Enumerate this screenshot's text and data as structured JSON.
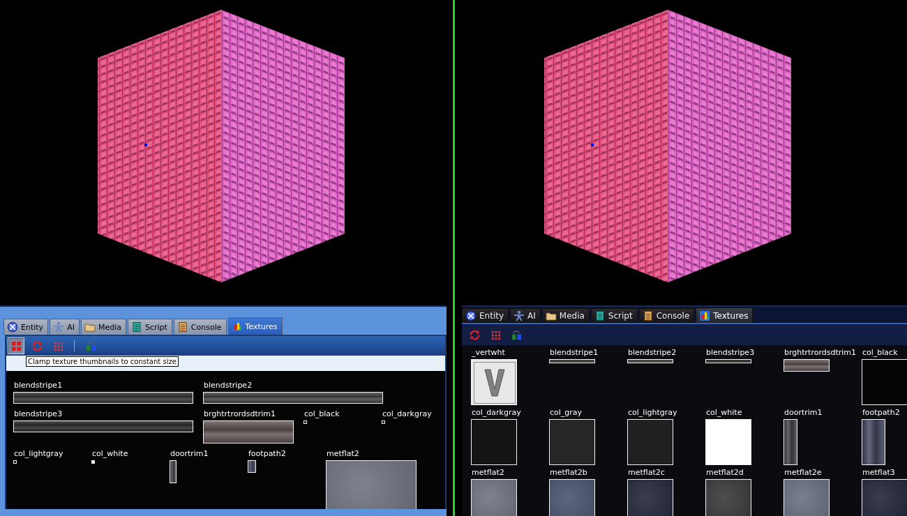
{
  "views": [
    {
      "kind": "light",
      "tabs": [
        {
          "label": "Entity",
          "kind": "entity",
          "selected": false
        },
        {
          "label": "AI",
          "kind": "ai",
          "selected": false
        },
        {
          "label": "Media",
          "kind": "media",
          "selected": false
        },
        {
          "label": "Script",
          "kind": "script",
          "selected": false
        },
        {
          "label": "Console",
          "kind": "console",
          "selected": false
        },
        {
          "label": "Textures",
          "kind": "textures",
          "selected": true
        }
      ],
      "toolbar": [
        {
          "kind": "clamp",
          "pressed": true
        },
        {
          "kind": "refresh",
          "pressed": false
        },
        {
          "kind": "dots",
          "pressed": false
        },
        {
          "kind": "separator"
        },
        {
          "kind": "swap",
          "pressed": false
        }
      ],
      "tooltip": "Clamp texture thumbnails to constant size",
      "textures": [
        {
          "name": "blendstripe1",
          "kind": "strip",
          "color": "#3c3c3c"
        },
        {
          "name": "blendstripe2",
          "kind": "strip",
          "color": "#4a4a4a"
        },
        {
          "name": "blendstripe3",
          "kind": "strip",
          "color": "#303030"
        },
        {
          "name": "brghtrtrordsdtrim1",
          "kind": "trim",
          "color": "#6a5c5c"
        },
        {
          "name": "col_black",
          "kind": "solid"
        },
        {
          "name": "col_darkgray",
          "kind": "solid"
        },
        {
          "name": "col_lightgray",
          "kind": "solid"
        },
        {
          "name": "col_white",
          "kind": "solid",
          "color": "#ffffff"
        },
        {
          "name": "doortrim1",
          "kind": "tall",
          "color": "#4a4a50"
        },
        {
          "name": "footpath2",
          "kind": "narrow",
          "color": "#4a4e66"
        },
        {
          "name": "metflat2",
          "kind": "square",
          "color": "#707480"
        }
      ]
    },
    {
      "kind": "dark",
      "tabs": [
        {
          "label": "Entity",
          "kind": "entity",
          "selected": false
        },
        {
          "label": "AI",
          "kind": "ai",
          "selected": false
        },
        {
          "label": "Media",
          "kind": "media",
          "selected": false
        },
        {
          "label": "Script",
          "kind": "script",
          "selected": false
        },
        {
          "label": "Console",
          "kind": "console",
          "selected": false
        },
        {
          "label": "Textures",
          "kind": "textures",
          "selected": true
        }
      ],
      "toolbar": [
        {
          "kind": "refresh",
          "pressed": false
        },
        {
          "kind": "dots",
          "pressed": false
        },
        {
          "kind": "swap",
          "pressed": false
        }
      ],
      "textures": [
        {
          "name": "_vertwht",
          "kind": "letter",
          "color": "#e8e8e8"
        },
        {
          "name": "blendstripe1",
          "kind": "strip",
          "color": "#3c3c3c"
        },
        {
          "name": "blendstripe2",
          "kind": "strip",
          "color": "#4a4a4a"
        },
        {
          "name": "blendstripe3",
          "kind": "strip",
          "color": "#303030"
        },
        {
          "name": "brghtrtrordsdtrim1",
          "kind": "trim",
          "color": "#6a5c5c"
        },
        {
          "name": "col_black",
          "kind": "solid",
          "color": "#050505"
        },
        {
          "name": "col_darkgray",
          "kind": "solid",
          "color": "#141414"
        },
        {
          "name": "col_gray",
          "kind": "solid",
          "color": "#262626"
        },
        {
          "name": "col_lightgray",
          "kind": "solid",
          "color": "#202020"
        },
        {
          "name": "col_white",
          "kind": "solid",
          "color": "#ffffff"
        },
        {
          "name": "doortrim1",
          "kind": "tall",
          "color": "#4a4a50"
        },
        {
          "name": "footpath2",
          "kind": "narrow",
          "color": "#4a4e66"
        },
        {
          "name": "metflat2",
          "kind": "square",
          "color": "#707480"
        },
        {
          "name": "metflat2b",
          "kind": "square",
          "color": "#4a5670"
        },
        {
          "name": "metflat2c",
          "kind": "square",
          "color": "#24283a"
        },
        {
          "name": "metflat2d",
          "kind": "square",
          "color": "#3a3a3a"
        },
        {
          "name": "metflat2e",
          "kind": "square",
          "color": "#6a7080"
        },
        {
          "name": "metflat3",
          "kind": "square",
          "color": "#22263a"
        }
      ]
    }
  ]
}
